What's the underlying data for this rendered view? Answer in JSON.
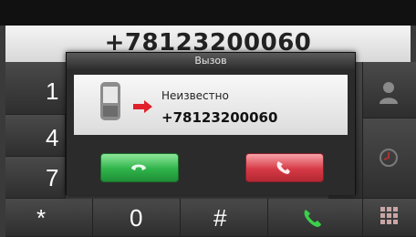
{
  "display": {
    "number": "+78123200060"
  },
  "dialog": {
    "title": "Вызов",
    "caller_name": "Неизвестно",
    "caller_number": "+78123200060",
    "accept_icon": "phone-answer-icon",
    "reject_icon": "phone-hangup-icon"
  },
  "keypad": {
    "keys": [
      "1",
      "4",
      "7",
      "*",
      "0",
      "#"
    ],
    "call_icon": "call-icon"
  },
  "sidebar": {
    "icons": [
      "contacts-icon",
      "clock-icon",
      "keypad-grid-icon"
    ]
  },
  "colors": {
    "accept": "#2fb34a",
    "reject": "#d63a45",
    "background": "#3a3a3a",
    "arrow": "#e0202a"
  }
}
